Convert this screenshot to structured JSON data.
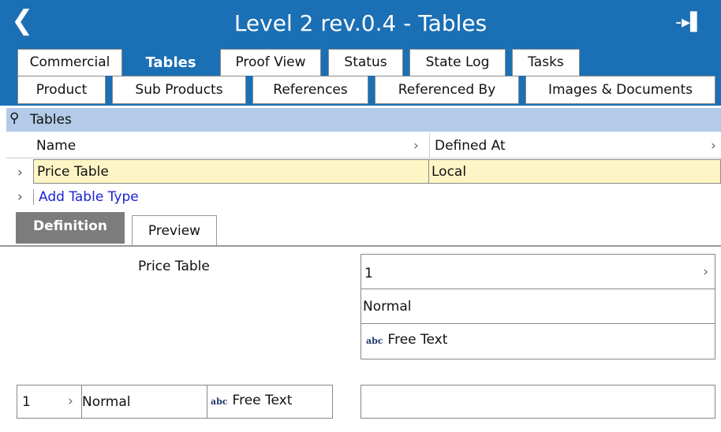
{
  "titlebar": {
    "back_icon": "back-chevron",
    "title": "Level 2 rev.0.4 - Tables",
    "pin_icon": "pin"
  },
  "tabs_row1": [
    {
      "label": "Commercial"
    },
    {
      "label": "Tables"
    },
    {
      "label": "Proof View"
    },
    {
      "label": "Status"
    },
    {
      "label": "State Log"
    },
    {
      "label": "Tasks"
    }
  ],
  "tabs_row2": [
    {
      "label": "Product"
    },
    {
      "label": "Sub Products"
    },
    {
      "label": "References"
    },
    {
      "label": "Referenced By"
    },
    {
      "label": "Images & Documents"
    }
  ],
  "active_tab": "Tables",
  "panel": {
    "title": "Tables",
    "columns": {
      "name": "Name",
      "defined_at": "Defined At"
    },
    "rows": [
      {
        "name": "Price Table",
        "defined_at": "Local"
      }
    ],
    "add_link": "Add Table Type"
  },
  "subtabs": {
    "definition": "Definition",
    "preview": "Preview",
    "active": "Definition"
  },
  "preview": {
    "table_title": "Price Table",
    "vertical": {
      "index": "1",
      "style": "Normal",
      "type_icon_text": "abc",
      "cell": "Free Text"
    },
    "horizontal": {
      "index": "1",
      "style": "Normal",
      "type_icon_text": "abc",
      "cell": "Free Text"
    }
  },
  "colors": {
    "accent": "#1b6fb5",
    "header_band": "#b3cbe8",
    "row_highlight": "#fdf5c5",
    "link": "#1a23d6"
  }
}
